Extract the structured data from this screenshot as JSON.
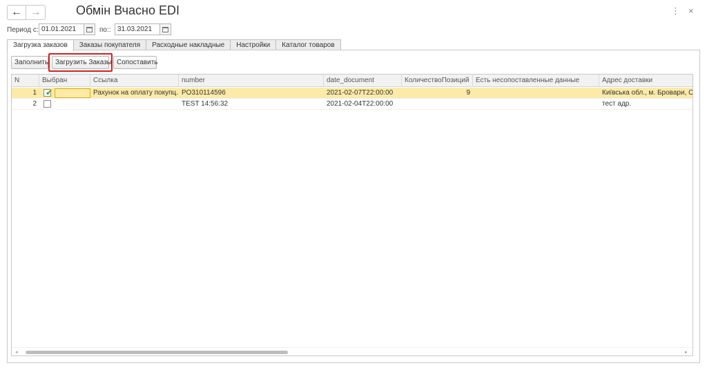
{
  "window": {
    "title": "Обмін Вчасно EDI",
    "back_icon": "←",
    "forward_icon": "→",
    "more_icon": "⋮",
    "close_icon": "×"
  },
  "period": {
    "from_label": "Период с::",
    "from_value": "01.01.2021",
    "to_label": "по::",
    "to_value": "31.03.2021"
  },
  "tabs": [
    {
      "label": "Загрузка заказов",
      "active": true
    },
    {
      "label": "Заказы покупателя",
      "active": false
    },
    {
      "label": "Расходные накладные",
      "active": false
    },
    {
      "label": "Настройки",
      "active": false
    },
    {
      "label": "Каталог товаров",
      "active": false
    }
  ],
  "toolbar": {
    "fill_label": "Заполнить",
    "load_label": "Загрузить Заказы",
    "match_label": "Сопоставить",
    "highlight_color": "#d02020"
  },
  "table": {
    "columns": [
      "N",
      "Выбран",
      "Ссылка",
      "number",
      "date_document",
      "КоличествоПозиций",
      "Есть несопоставленные данные",
      "Адрес доставки"
    ],
    "rows": [
      {
        "n": "1",
        "selected": true,
        "link": "Рахунок на оплату покупц...",
        "number": "PO310114596",
        "date_document": "2021-02-07T22:00:00",
        "count": "9",
        "unmatched": "",
        "address": "Київська обл., м. Бровари, Об"
      },
      {
        "n": "2",
        "selected": false,
        "link": "",
        "number": "TEST 14:56:32",
        "date_document": "2021-02-04T22:00:00",
        "count": "",
        "unmatched": "",
        "address": "тест адр."
      }
    ],
    "selected_row_color": "#fbeaa8",
    "check_mark": "✔",
    "scroll_left": "◂",
    "scroll_right": "▸"
  }
}
